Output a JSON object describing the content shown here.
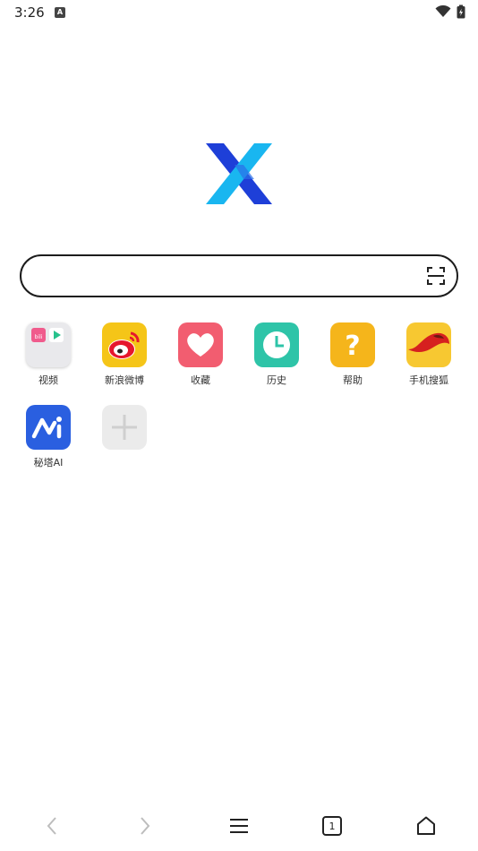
{
  "status_bar": {
    "time": "3:26",
    "notification_icon": "android-a-icon",
    "wifi_icon": "wifi-icon",
    "battery_icon": "battery-charging-icon"
  },
  "logo": {
    "icon": "x-browser-logo"
  },
  "search": {
    "value": "",
    "placeholder": "",
    "scan_icon": "scan-icon"
  },
  "shortcuts": [
    {
      "label": "视频",
      "icon": "video-folder-icon"
    },
    {
      "label": "新浪微博",
      "icon": "weibo-icon"
    },
    {
      "label": "收藏",
      "icon": "heart-icon"
    },
    {
      "label": "历史",
      "icon": "clock-icon"
    },
    {
      "label": "帮助",
      "icon": "question-icon"
    },
    {
      "label": "手机搜狐",
      "icon": "sohu-icon"
    },
    {
      "label": "秘塔AI",
      "icon": "metaso-icon"
    },
    {
      "label": "",
      "icon": "add-icon"
    }
  ],
  "bottom_nav": {
    "back_icon": "chevron-left-icon",
    "forward_icon": "chevron-right-icon",
    "menu_icon": "menu-icon",
    "tabs_count": "1",
    "home_icon": "home-icon"
  },
  "colors": {
    "weibo": "#f5c518",
    "favorites": "#f25d70",
    "history": "#2ec4a8",
    "help": "#f5b51b",
    "sohu": "#f7c831",
    "metaso": "#2a5fe0",
    "logo_dark": "#1e3fd8",
    "logo_light": "#19b6f0"
  }
}
